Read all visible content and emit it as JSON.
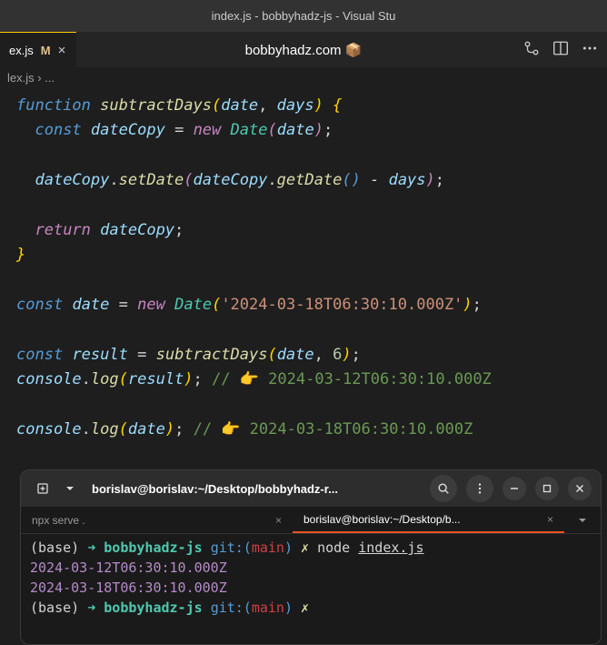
{
  "titleBar": "index.js - bobbyhadz-js - Visual Stu",
  "tab": {
    "name": "ex.js",
    "modified": "M",
    "close": "×"
  },
  "centerBanner": "bobbyhadz.com 📦",
  "breadcrumb": "lex.js › ...",
  "code": {
    "l1": {
      "kw": "function",
      "fn": "subtractDays",
      "p1": "date",
      "p2": "days"
    },
    "l2": {
      "kw": "const",
      "var": "dateCopy",
      "new": "new",
      "type": "Date",
      "arg": "date"
    },
    "l3": {
      "obj": "dateCopy",
      "m1": "setDate",
      "obj2": "dateCopy",
      "m2": "getDate",
      "p": "days"
    },
    "l4": {
      "ret": "return",
      "var": "dateCopy"
    },
    "l5": {
      "kw": "const",
      "var": "date",
      "new": "new",
      "type": "Date",
      "str": "'2024-03-18T06:30:10.000Z'"
    },
    "l6": {
      "kw": "const",
      "var": "result",
      "fn": "subtractDays",
      "a1": "date",
      "n": "6"
    },
    "l7": {
      "obj": "console",
      "m": "log",
      "arg": "result",
      "comment": "// 👉️ 2024-03-12T06:30:10.000Z"
    },
    "l8": {
      "obj": "console",
      "m": "log",
      "arg": "date",
      "comment": "// 👉️ 2024-03-18T06:30:10.000Z"
    }
  },
  "terminal": {
    "headerTitle": "borislav@borislav:~/Desktop/bobbyhadz-r...",
    "tabs": {
      "t1": "npx serve .",
      "t2": "borislav@borislav:~/Desktop/b..."
    },
    "prompt": {
      "base": "(base)",
      "arrow": "➜",
      "dir": "bobbyhadz-js",
      "git": "git:(",
      "branch": "main",
      "gitClose": ")",
      "x": "✗",
      "cmd": "node",
      "file": "index.js"
    },
    "output": {
      "l1": "2024-03-12T06:30:10.000Z",
      "l2": "2024-03-18T06:30:10.000Z"
    }
  }
}
